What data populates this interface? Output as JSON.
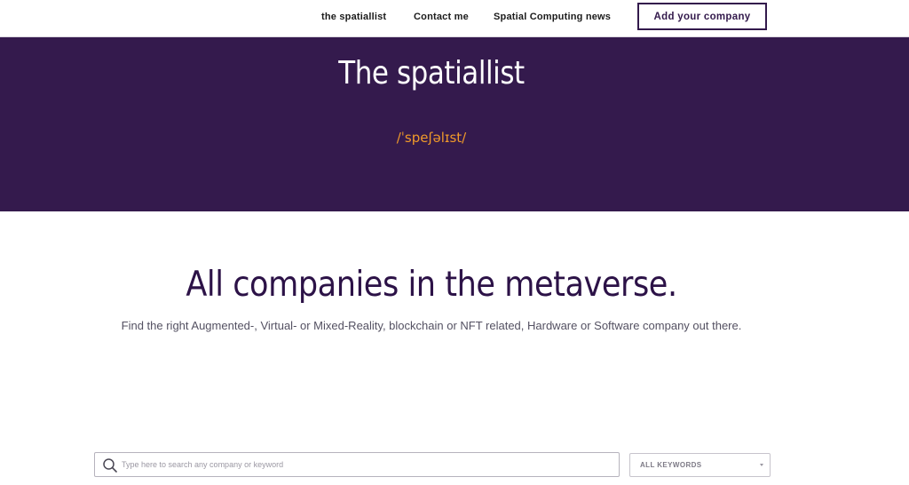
{
  "nav": {
    "items": [
      {
        "label": "the spatiallist"
      },
      {
        "label": "Contact me"
      },
      {
        "label": "Spatial Computing news"
      }
    ],
    "cta_label": "Add your company"
  },
  "hero": {
    "title": "The spatiallist",
    "phonetic": "/ˈspeʃəlɪst/"
  },
  "main": {
    "headline": "All companies in the metaverse.",
    "subtext": "Find the right Augmented-, Virtual- or Mixed-Reality, blockchain or NFT related, Hardware or Software company out there."
  },
  "search": {
    "icon": "search-icon",
    "placeholder": "Type here to search any company or keyword",
    "value": ""
  },
  "filter": {
    "selected": "ALL KEYWORDS",
    "icon": "chevron-down-icon"
  },
  "colors": {
    "brand_purple": "#341a4d",
    "accent_orange": "#f09a2a",
    "headline_purple": "#2c1247"
  }
}
